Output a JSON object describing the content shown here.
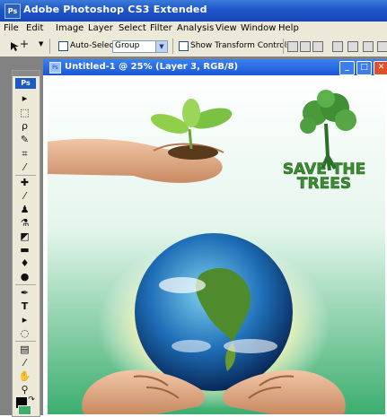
{
  "app": {
    "title": "Adobe Photoshop CS3 Extended",
    "icon_text": "Ps",
    "icon": "photoshop-icon"
  },
  "menu": [
    "File",
    "Edit",
    "Image",
    "Layer",
    "Select",
    "Filter",
    "Analysis",
    "View",
    "Window",
    "Help"
  ],
  "options": {
    "auto_select_label": "Auto-Select:",
    "auto_select_checked": false,
    "auto_select_value": "Group",
    "show_transform_label": "Show Transform Controls",
    "show_transform_checked": false
  },
  "toolbox": {
    "logo": "Ps",
    "tools": [
      "move-tool",
      "marquee-tool",
      "lasso-tool",
      "magic-wand-tool",
      "crop-tool",
      "slice-tool",
      "healing-brush-tool",
      "brush-tool",
      "clone-stamp-tool",
      "history-brush-tool",
      "eraser-tool",
      "gradient-tool",
      "blur-tool",
      "dodge-tool",
      "pen-tool",
      "type-tool",
      "path-selection-tool",
      "shape-tool",
      "notes-tool",
      "eyedropper-tool",
      "hand-tool",
      "zoom-tool"
    ],
    "foreground_color": "#000000",
    "background_color": "#3fae6a"
  },
  "document": {
    "title": "Untitled-1 @ 25% (Layer 3, RGB/8)",
    "zoom": "25%",
    "minimize_icon": "minimize-icon",
    "maximize_icon": "maximize-icon",
    "close_icon": "close-icon"
  },
  "artwork": {
    "headline_line1": "SAVE THE",
    "headline_line2": "TREES",
    "headline_color": "#3c8f2f",
    "background_top": "#ffffff",
    "background_bottom": "#3cae6e"
  }
}
